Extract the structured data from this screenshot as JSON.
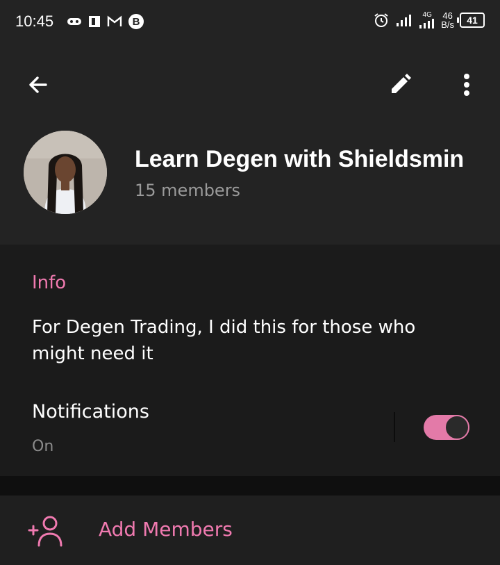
{
  "status_bar": {
    "time": "10:45",
    "net_speed_top": "46",
    "net_speed_bottom": "B/s",
    "signal_label": "4G",
    "battery": "41"
  },
  "toolbar": {
    "back_icon": "arrow-left-icon",
    "edit_icon": "pencil-icon",
    "more_icon": "more-vertical-icon"
  },
  "group": {
    "name": "Learn Degen with Shieldsmin",
    "members": "15 members"
  },
  "info": {
    "title": "Info",
    "description": "For Degen Trading, I did this for those who might need it"
  },
  "notifications": {
    "label": "Notifications",
    "status": "On",
    "enabled": true
  },
  "actions": {
    "add_members": "Add Members"
  },
  "colors": {
    "accent": "#f07ab0",
    "toggle": "#e37aa8",
    "background": "#232323"
  }
}
